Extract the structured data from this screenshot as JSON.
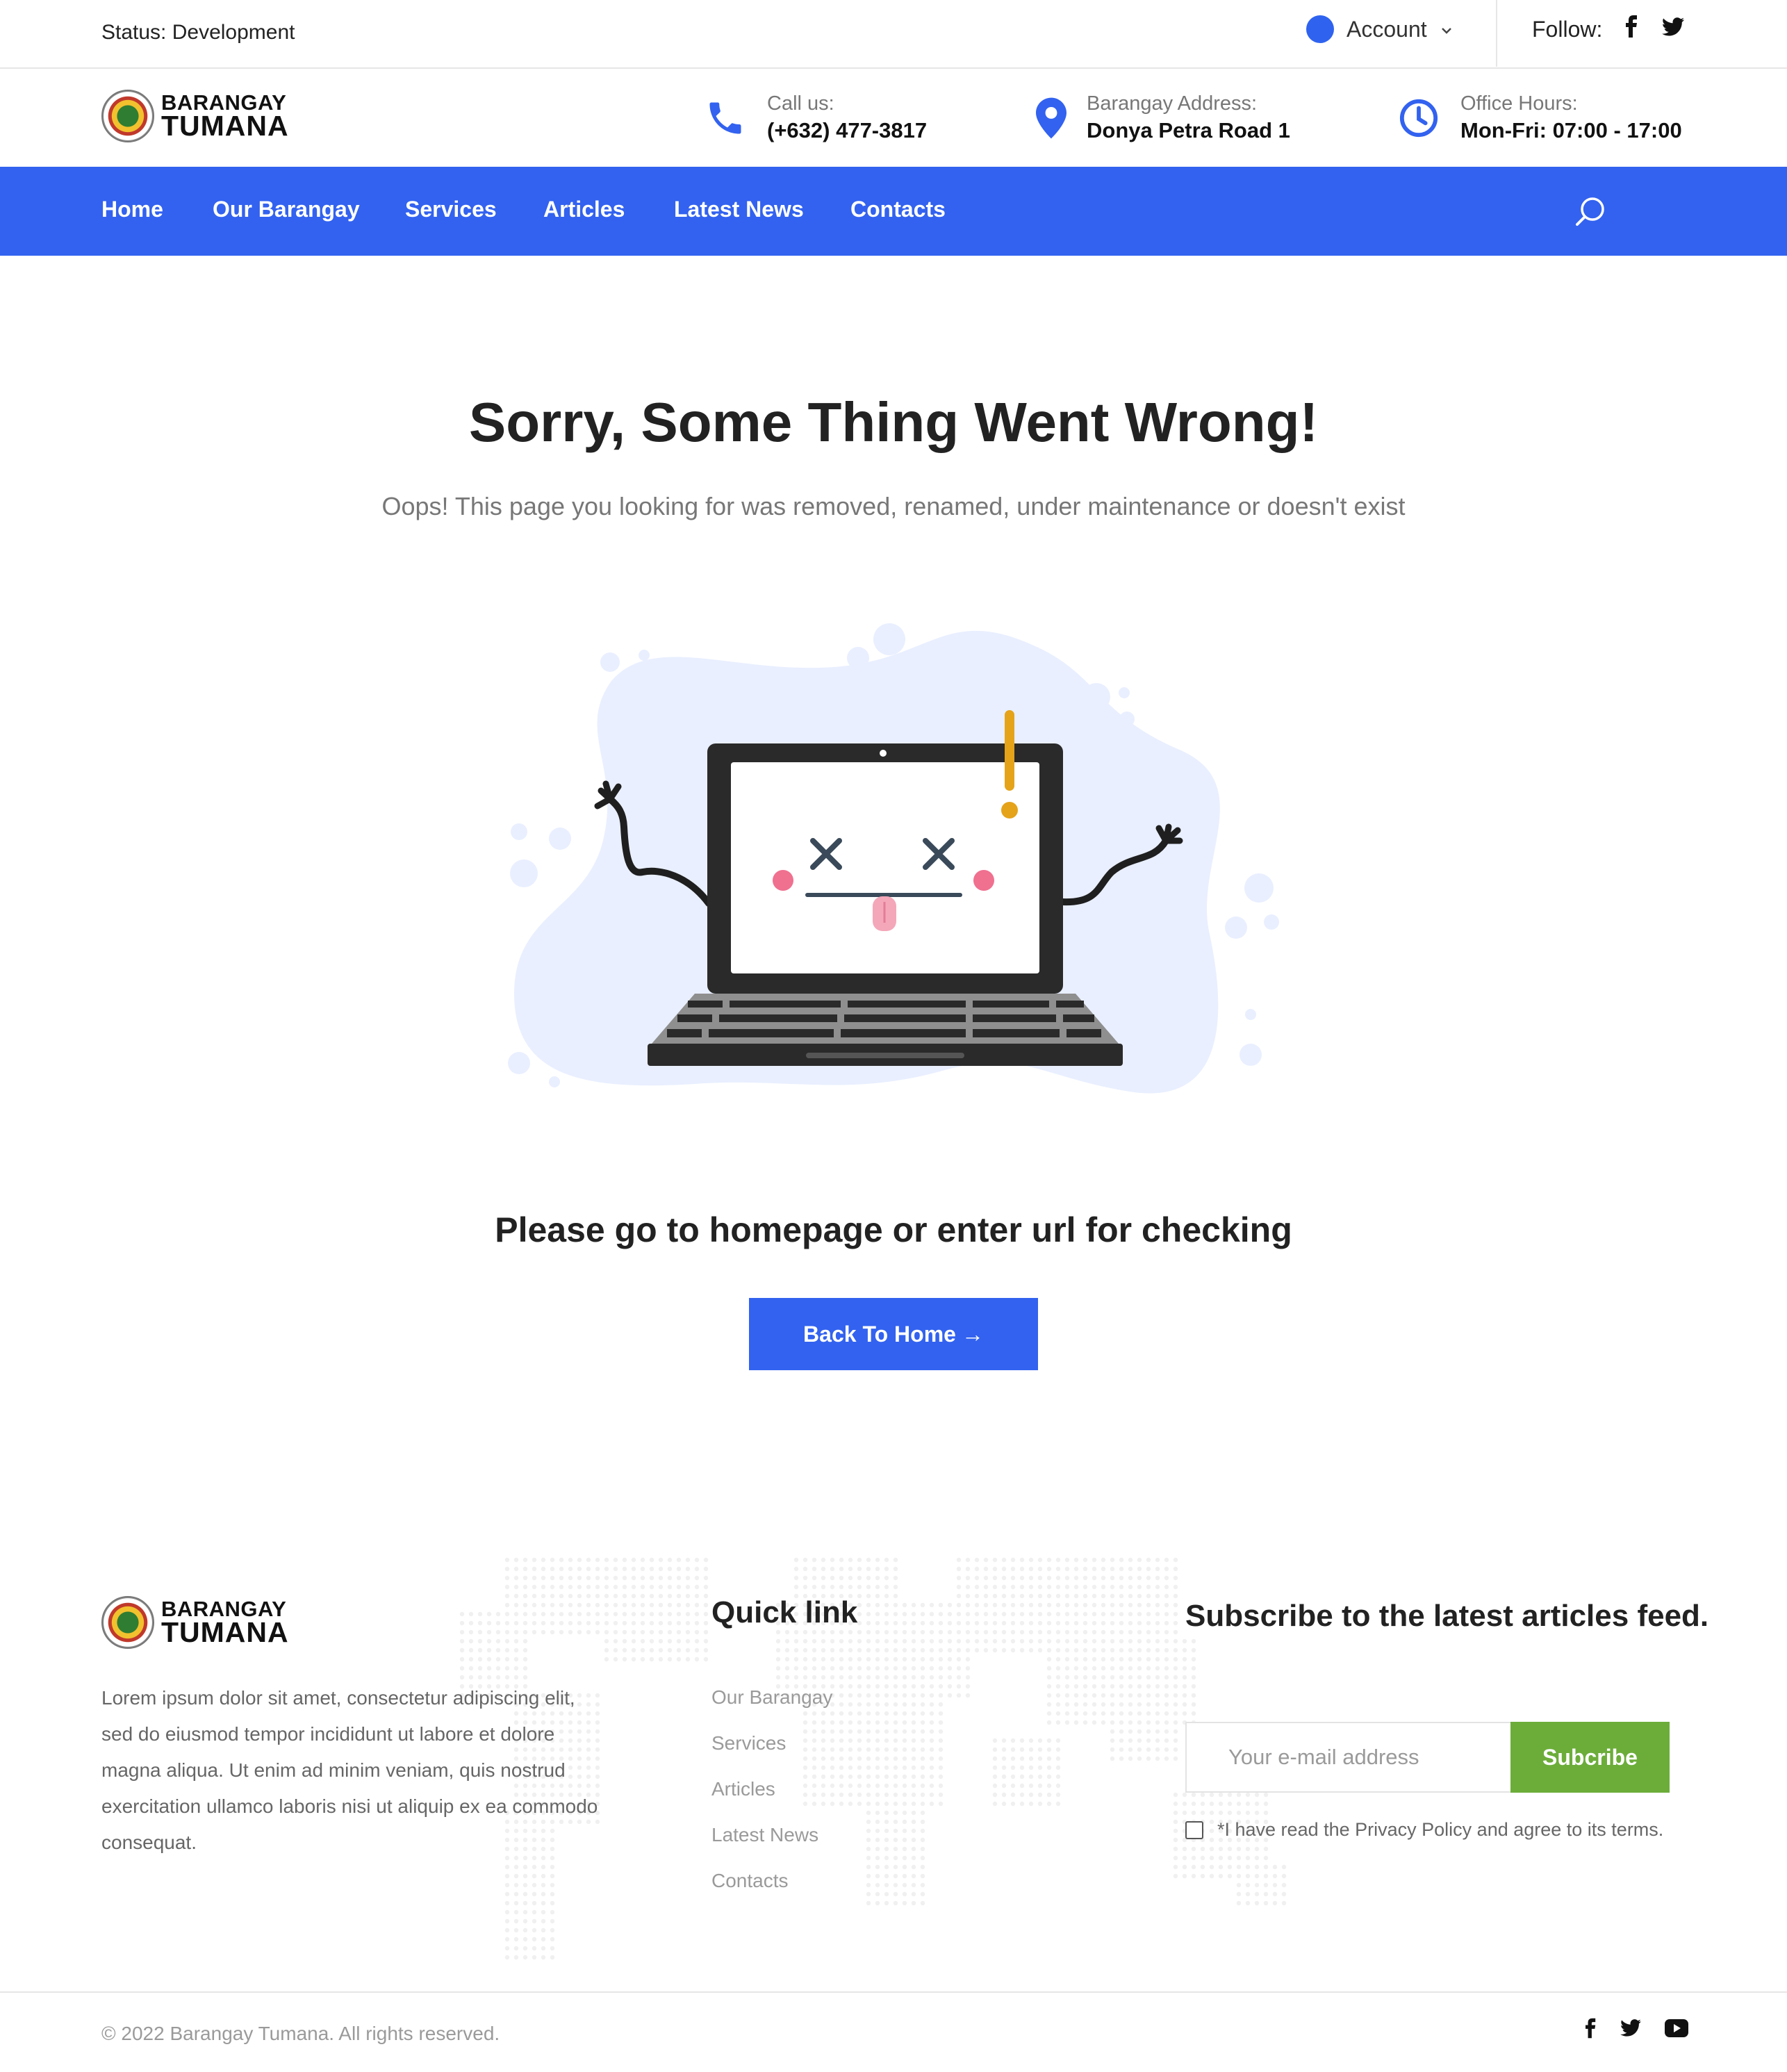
{
  "topbar": {
    "status": "Status: Development",
    "account_label": "Account",
    "follow_label": "Follow:",
    "social": [
      "facebook-icon",
      "twitter-icon"
    ]
  },
  "brand": {
    "line1": "BARANGAY",
    "line2": "TUMANA"
  },
  "header": {
    "call_label": "Call us:",
    "call_value": "(+632) 477-3817",
    "address_label": "Barangay Address:",
    "address_value": "Donya Petra Road 1",
    "hours_label": "Office Hours:",
    "hours_value": "Mon-Fri: 07:00 - 17:00"
  },
  "nav": {
    "items": [
      "Home",
      "Our Barangay",
      "Services",
      "Articles",
      "Latest News",
      "Contacts"
    ]
  },
  "main": {
    "title": "Sorry, Some Thing Went Wrong!",
    "subtitle": "Oops! This page you looking for was removed, renamed, under maintenance or doesn't exist",
    "cta_text": "Please go to homepage or enter url for checking",
    "button_label": "Back To Home",
    "button_arrow": "→"
  },
  "footer": {
    "about": "Lorem ipsum dolor sit amet, consectetur adipiscing elit, sed do eiusmod tempor incididunt ut labore et dolore magna aliqua. Ut enim ad minim veniam, quis nostrud exercitation ullamco laboris nisi ut aliquip ex ea commodo consequat.",
    "quick_title": "Quick link",
    "quick_links": [
      "Our Barangay",
      "Services",
      "Articles",
      "Latest News",
      "Contacts"
    ],
    "subscribe_title": "Subscribe to the latest articles feed.",
    "email_placeholder": "Your e-mail address",
    "subscribe_button": "Subcribe",
    "agree_text": "*I have read the Privacy Policy and agree to its terms.",
    "copyright": "© 2022 Barangay Tumana. All rights reserved.",
    "social": [
      "facebook-icon",
      "twitter-icon",
      "youtube-icon"
    ]
  },
  "colors": {
    "primary": "#3262ef",
    "subscribe": "#6cad3a",
    "blob": "#e9efff"
  }
}
